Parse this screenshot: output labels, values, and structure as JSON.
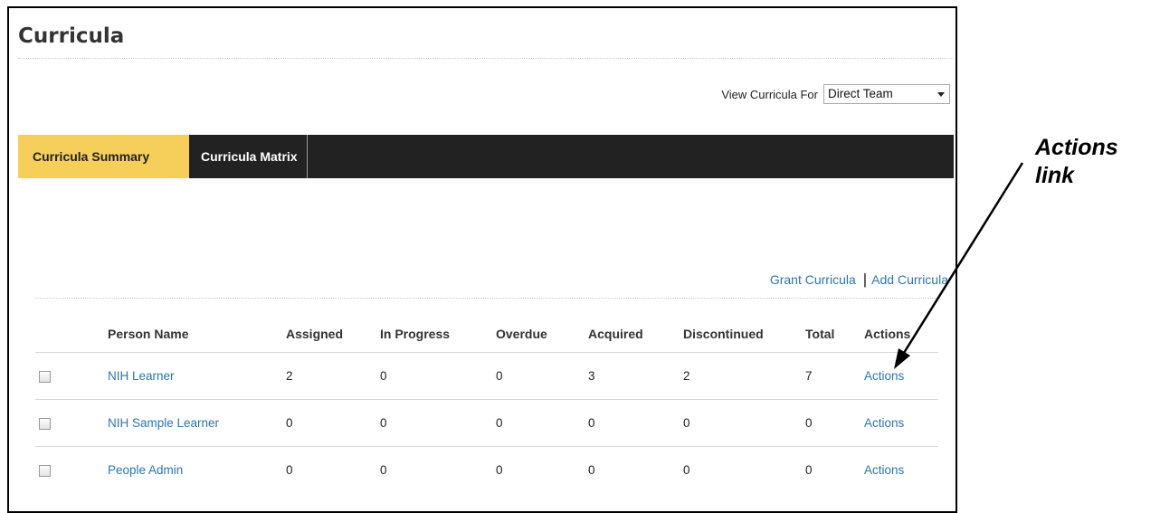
{
  "page": {
    "title": "Curricula"
  },
  "view_filter": {
    "label": "View Curricula For",
    "selected": "Direct Team"
  },
  "tabs": [
    {
      "label": "Curricula Summary",
      "active": true
    },
    {
      "label": "Curricula Matrix",
      "active": false
    }
  ],
  "links": {
    "grant": "Grant Curricula",
    "separator": "|",
    "add": "Add Curricula"
  },
  "table": {
    "headers": [
      "Person Name",
      "Assigned",
      "In Progress",
      "Overdue",
      "Acquired",
      "Discontinued",
      "Total",
      "Actions"
    ],
    "rows": [
      {
        "name": "NIH Learner",
        "assigned": "2",
        "in_progress": "0",
        "overdue": "0",
        "acquired": "3",
        "discontinued": "2",
        "total": "7",
        "actions": "Actions"
      },
      {
        "name": "NIH Sample Learner",
        "assigned": "0",
        "in_progress": "0",
        "overdue": "0",
        "acquired": "0",
        "discontinued": "0",
        "total": "0",
        "actions": "Actions"
      },
      {
        "name": "People Admin",
        "assigned": "0",
        "in_progress": "0",
        "overdue": "0",
        "acquired": "0",
        "discontinued": "0",
        "total": "0",
        "actions": "Actions"
      }
    ]
  },
  "annotation": {
    "line1": "Actions",
    "line2": "link"
  },
  "colors": {
    "active_tab": "#f5cf5a",
    "tab_bar": "#222222",
    "link": "#2a75b3"
  },
  "icons": {
    "select": "chevron-down-icon",
    "annotation": "arrow-icon"
  }
}
